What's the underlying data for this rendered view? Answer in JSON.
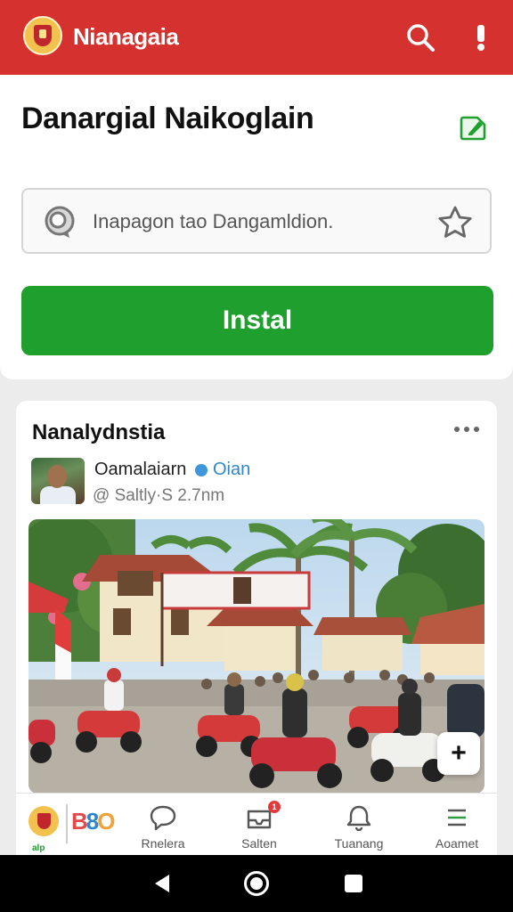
{
  "app_bar": {
    "title": "Nianagaia",
    "logo_icon": "garuda-emblem-icon",
    "actions": [
      "search-icon",
      "alert-icon"
    ],
    "color": "#d5322f"
  },
  "header": {
    "title": "Danargial Naikoglain",
    "edit_icon": "edit-icon",
    "search": {
      "placeholder": "Inapagon tao Dangamldion.",
      "icon": "search-bubble-icon",
      "trailing_icon": "star-icon"
    },
    "install_label": "Instal",
    "install_color": "#1e9f2e"
  },
  "feed": {
    "title": "Nanalydnstia",
    "more_icon": "more-icon",
    "post": {
      "author": "Oamalaiarn",
      "author_tag": "Oian",
      "meta": "@ Saltly·S 2.7nm",
      "image_icon": "street-scene-photo",
      "fab_label": "+"
    }
  },
  "bottom_nav": {
    "logo_tag": "alp",
    "items": [
      {
        "label": "Rnelera",
        "icon": "chat-bubble-icon"
      },
      {
        "label": "Salten",
        "icon": "inbox-icon",
        "badge": "1"
      },
      {
        "label": "Tuanang",
        "icon": "notifications-icon"
      },
      {
        "label": "Aoamet",
        "icon": "menu-icon"
      }
    ]
  }
}
